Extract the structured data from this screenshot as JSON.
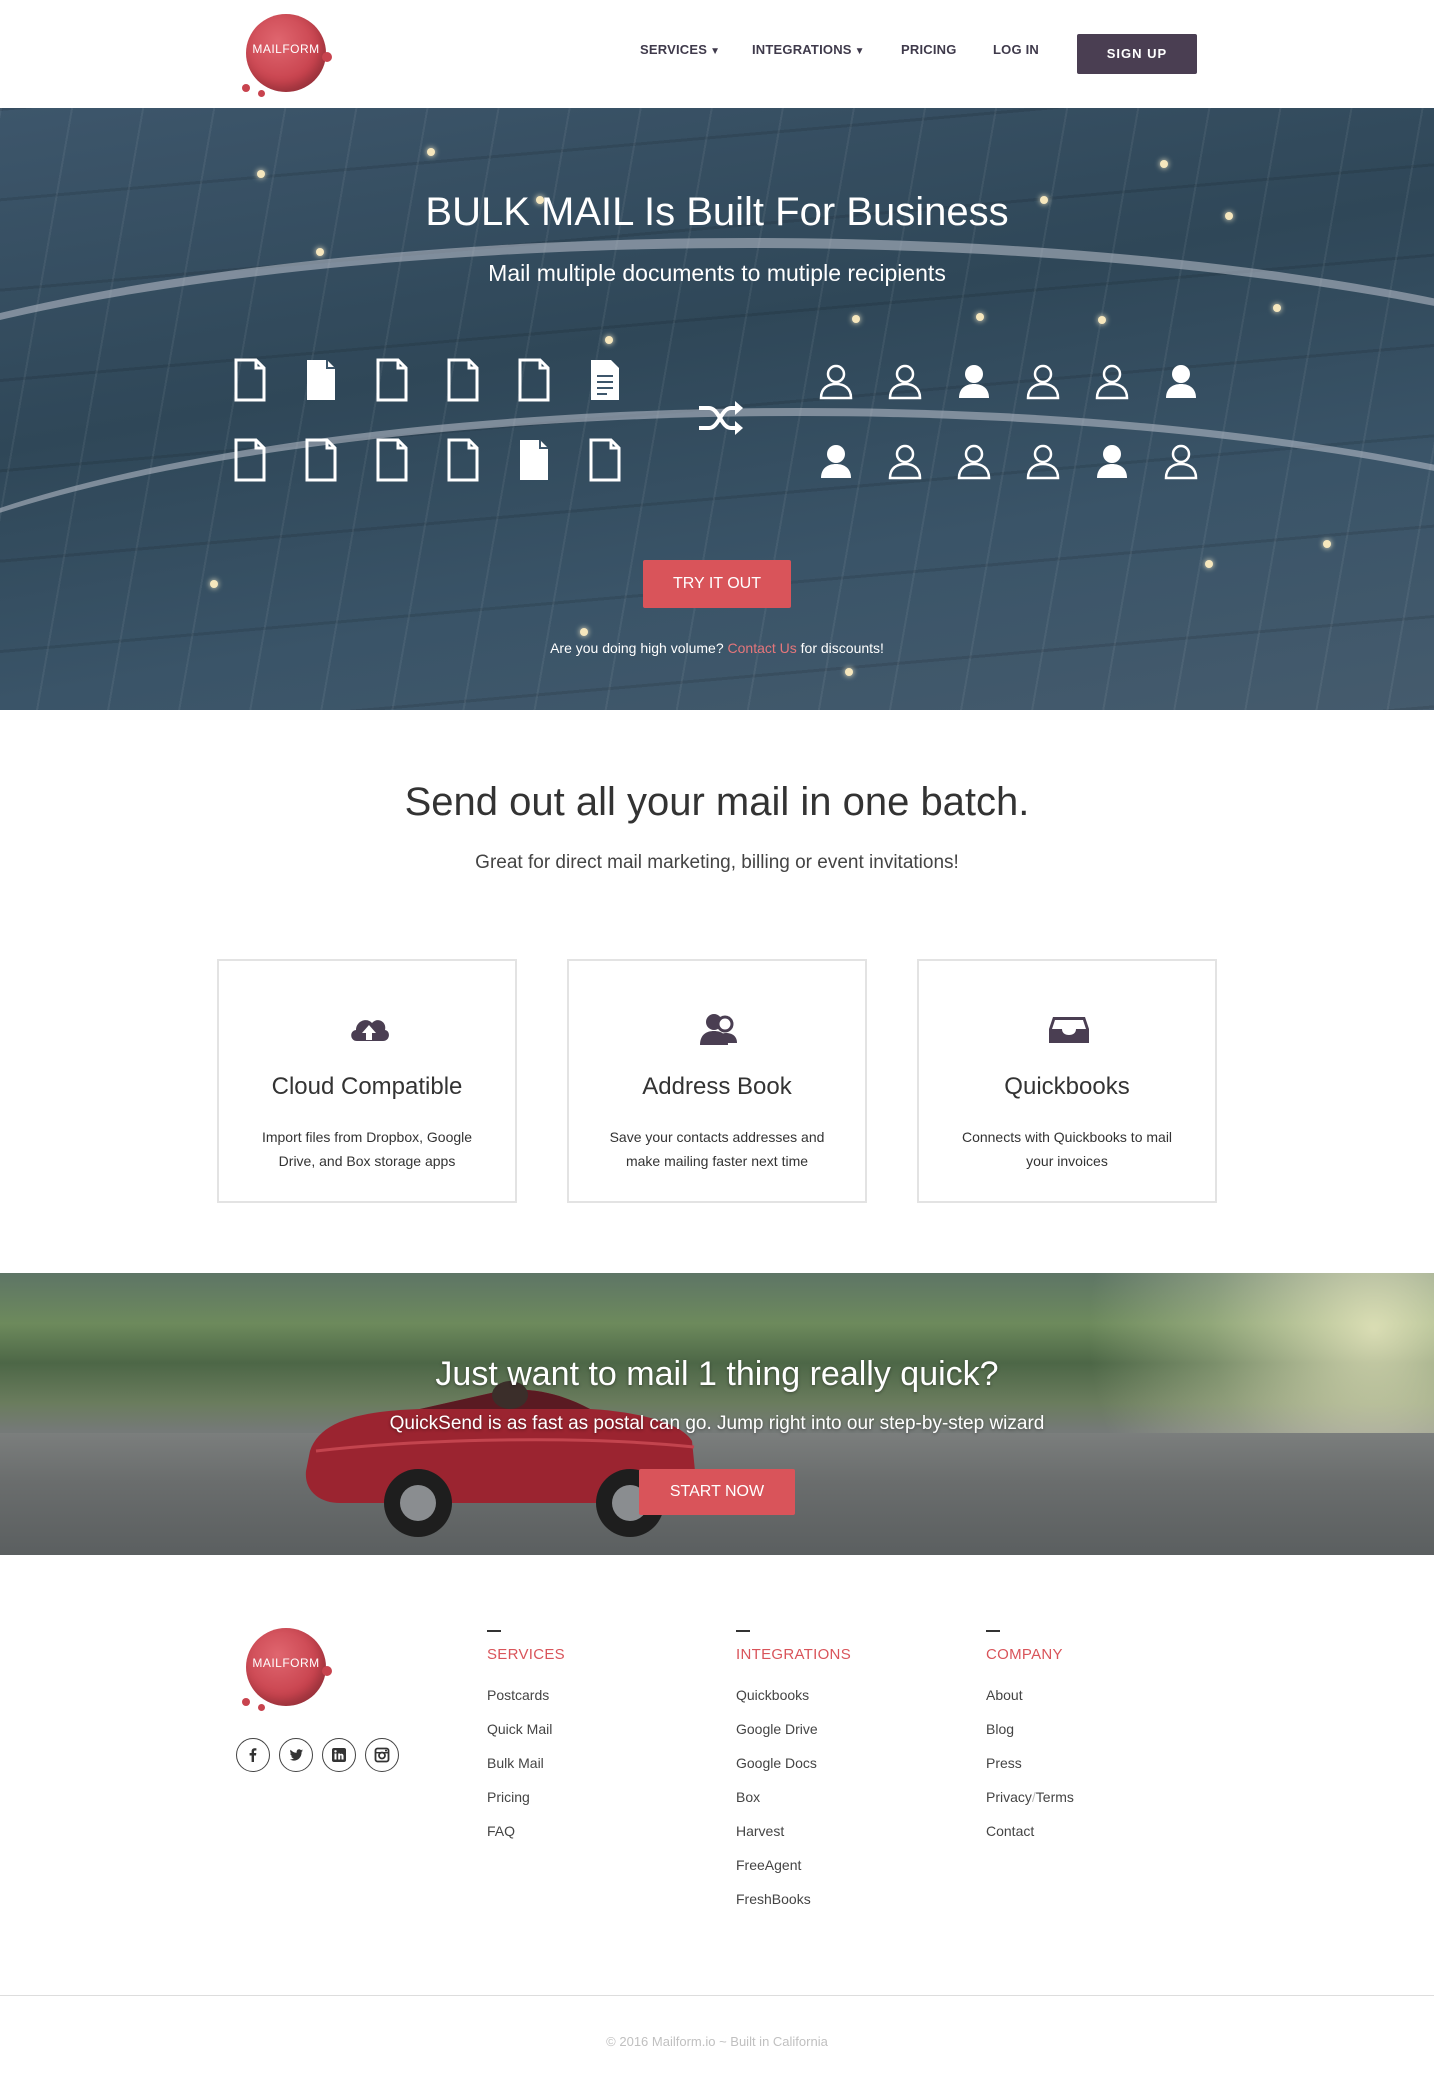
{
  "brand": {
    "logo_text": "MAILFORM",
    "accent": "#d9545a",
    "dark": "#4a3e52"
  },
  "nav": {
    "services": "SERVICES",
    "integrations": "INTEGRATIONS",
    "pricing": "PRICING",
    "login": "LOG IN",
    "signup": "SIGN UP"
  },
  "hero": {
    "title": "BULK MAIL Is Built For Business",
    "subtitle": "Mail multiple documents to mutiple recipients",
    "cta": "TRY IT OUT",
    "note_before": "Are you doing high volume?",
    "note_link": "Contact Us",
    "note_after": "for discounts!",
    "document_icons": [
      "document-outline-icon",
      "document-filled-icon",
      "document-lines-icon"
    ],
    "recipient_icons": [
      "user-outline-icon",
      "user-filled-icon"
    ]
  },
  "batch": {
    "title": "Send out all your mail in one batch.",
    "subtitle": "Great for direct mail marketing, billing or event invitations!"
  },
  "features": [
    {
      "icon": "cloud-upload-icon",
      "title": "Cloud Compatible",
      "desc": "Import files from Dropbox, Google Drive, and Box storage apps"
    },
    {
      "icon": "address-book-icon",
      "title": "Address Book",
      "desc": "Save your contacts addresses and make mailing faster next time"
    },
    {
      "icon": "inbox-icon",
      "title": "Quickbooks",
      "desc": "Connects with Quickbooks to mail your invoices"
    }
  ],
  "quick": {
    "title": "Just want to mail 1 thing really quick?",
    "subtitle": "QuickSend is as fast as postal can go. Jump right into our step-by-step wizard",
    "cta": "START NOW"
  },
  "footer": {
    "social": [
      "facebook-icon",
      "twitter-icon",
      "linkedin-icon",
      "instagram-icon"
    ],
    "services": {
      "heading": "SERVICES",
      "links": [
        "Postcards",
        "Quick Mail",
        "Bulk Mail",
        "Pricing",
        "FAQ"
      ]
    },
    "integrations": {
      "heading": "INTEGRATIONS",
      "links": [
        "Quickbooks",
        "Google Drive",
        "Google Docs",
        "Box",
        "Harvest",
        "FreeAgent",
        "FreshBooks"
      ]
    },
    "company": {
      "heading": "COMPANY",
      "links": [
        "About",
        "Blog",
        "Press",
        "Privacy",
        "Terms",
        "Contact"
      ],
      "separator": "/"
    },
    "copyright": "© 2016 Mailform.io ~ Built in California"
  }
}
